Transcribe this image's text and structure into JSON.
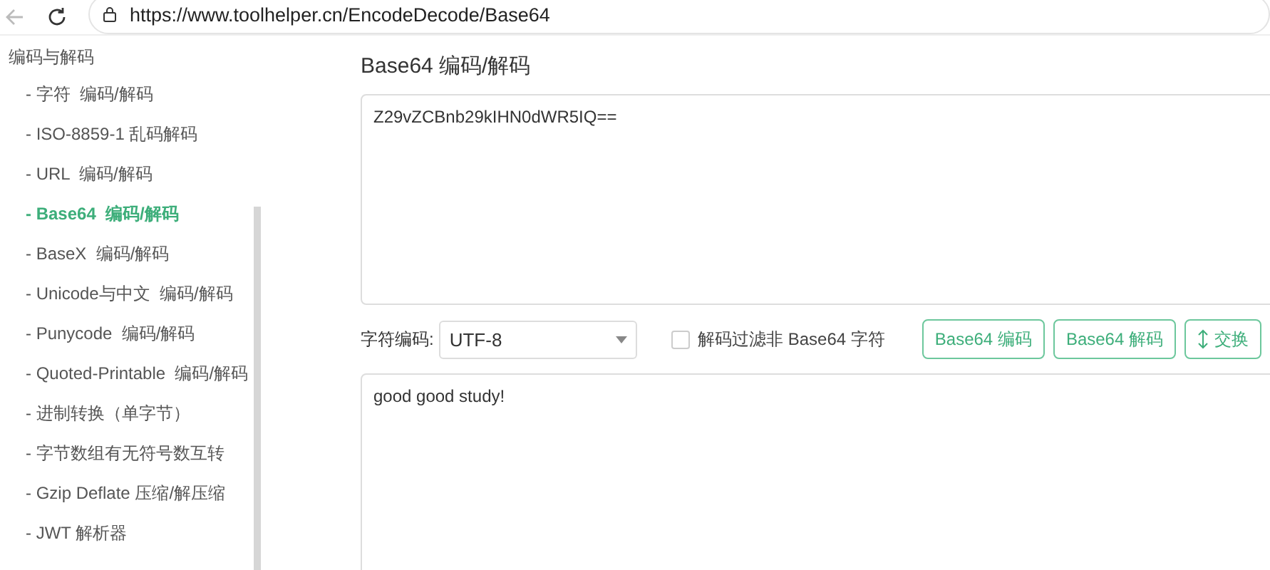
{
  "browser": {
    "url": "https://www.toolhelper.cn/EncodeDecode/Base64"
  },
  "sidebar": {
    "heading": "编码与解码",
    "items": [
      {
        "label": "- 字符  编码/解码",
        "selected": false
      },
      {
        "label": "- ISO-8859-1 乱码解码",
        "selected": false
      },
      {
        "label": "- URL  编码/解码",
        "selected": false
      },
      {
        "label": "- Base64  编码/解码",
        "selected": true
      },
      {
        "label": "- BaseX  编码/解码",
        "selected": false
      },
      {
        "label": "- Unicode与中文  编码/解码",
        "selected": false
      },
      {
        "label": "- Punycode  编码/解码",
        "selected": false
      },
      {
        "label": "- Quoted-Printable  编码/解码",
        "selected": false
      },
      {
        "label": "- 进制转换（单字节）",
        "selected": false
      },
      {
        "label": "- 字节数组有无符号数互转",
        "selected": false
      },
      {
        "label": "- Gzip Deflate 压缩/解压缩",
        "selected": false
      },
      {
        "label": "- JWT 解析器",
        "selected": false
      }
    ]
  },
  "main": {
    "title": "Base64 编码/解码",
    "input": "Z29vZCBnb29kIHN0dWR5IQ==",
    "charset_label": "字符编码:",
    "charset": "UTF-8",
    "filter": {
      "label": "解码过滤非 Base64 字符",
      "checked": false
    },
    "buttons": [
      {
        "label": "Base64 编码",
        "kind": "plain"
      },
      {
        "label": "Base64 解码",
        "kind": "plain"
      },
      {
        "label": "交换",
        "kind": "swap"
      }
    ],
    "output": "good good study!"
  }
}
